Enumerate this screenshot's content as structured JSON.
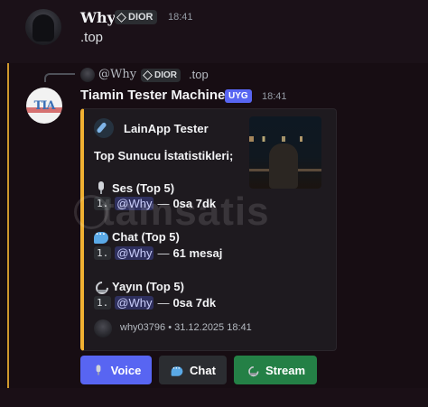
{
  "message1": {
    "username": "Why",
    "tag": "DIOR",
    "time": "18:41",
    "content": ".top"
  },
  "message2": {
    "reply": {
      "username": "@Why",
      "tag": "DIOR",
      "content": ".top"
    },
    "username": "Tiamin Tester Machine",
    "bot_tag": "UYG",
    "time": "18:41",
    "embed": {
      "author": "LainApp Tester",
      "title": "Top Sunucu İstatistikleri;",
      "sections": [
        {
          "title": "Ses (Top 5)",
          "icon": "microphone-icon",
          "rank": "1.",
          "mention": "@Why",
          "dash": "—",
          "value": "0sa 7dk"
        },
        {
          "title": "Chat (Top 5)",
          "icon": "speech-bubble-icon",
          "rank": "1.",
          "mention": "@Why",
          "dash": "—",
          "value": "61 mesaj"
        },
        {
          "title": "Yayın (Top 5)",
          "icon": "satellite-icon",
          "rank": "1.",
          "mention": "@Why",
          "dash": "—",
          "value": "0sa 7dk"
        }
      ],
      "footer": "why03796 • 31.12.2025 18:41",
      "accent_color": "#f0b132"
    },
    "buttons": [
      {
        "label": "Voice",
        "icon": "microphone-icon",
        "color": "#5865f2"
      },
      {
        "label": "Chat",
        "icon": "speech-bubble-icon",
        "color": "#2b2d31"
      },
      {
        "label": "Stream",
        "icon": "satellite-icon",
        "color": "#248046"
      }
    ]
  },
  "watermark": "tamsatis"
}
